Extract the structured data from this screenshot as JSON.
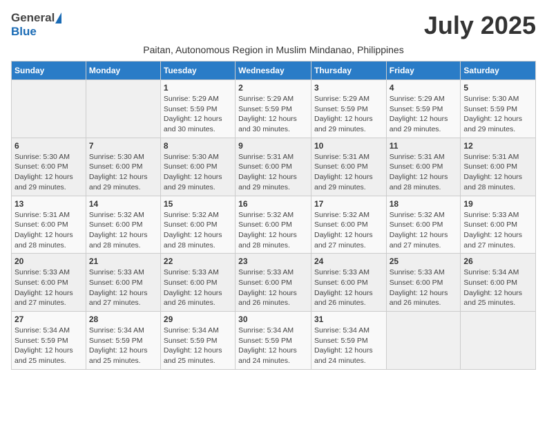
{
  "header": {
    "logo_general": "General",
    "logo_blue": "Blue",
    "title": "July 2025",
    "subtitle": "Paitan, Autonomous Region in Muslim Mindanao, Philippines"
  },
  "days_of_week": [
    "Sunday",
    "Monday",
    "Tuesday",
    "Wednesday",
    "Thursday",
    "Friday",
    "Saturday"
  ],
  "weeks": [
    [
      {
        "day": "",
        "info": ""
      },
      {
        "day": "",
        "info": ""
      },
      {
        "day": "1",
        "sunrise": "Sunrise: 5:29 AM",
        "sunset": "Sunset: 5:59 PM",
        "daylight": "Daylight: 12 hours and 30 minutes."
      },
      {
        "day": "2",
        "sunrise": "Sunrise: 5:29 AM",
        "sunset": "Sunset: 5:59 PM",
        "daylight": "Daylight: 12 hours and 30 minutes."
      },
      {
        "day": "3",
        "sunrise": "Sunrise: 5:29 AM",
        "sunset": "Sunset: 5:59 PM",
        "daylight": "Daylight: 12 hours and 29 minutes."
      },
      {
        "day": "4",
        "sunrise": "Sunrise: 5:29 AM",
        "sunset": "Sunset: 5:59 PM",
        "daylight": "Daylight: 12 hours and 29 minutes."
      },
      {
        "day": "5",
        "sunrise": "Sunrise: 5:30 AM",
        "sunset": "Sunset: 5:59 PM",
        "daylight": "Daylight: 12 hours and 29 minutes."
      }
    ],
    [
      {
        "day": "6",
        "sunrise": "Sunrise: 5:30 AM",
        "sunset": "Sunset: 6:00 PM",
        "daylight": "Daylight: 12 hours and 29 minutes."
      },
      {
        "day": "7",
        "sunrise": "Sunrise: 5:30 AM",
        "sunset": "Sunset: 6:00 PM",
        "daylight": "Daylight: 12 hours and 29 minutes."
      },
      {
        "day": "8",
        "sunrise": "Sunrise: 5:30 AM",
        "sunset": "Sunset: 6:00 PM",
        "daylight": "Daylight: 12 hours and 29 minutes."
      },
      {
        "day": "9",
        "sunrise": "Sunrise: 5:31 AM",
        "sunset": "Sunset: 6:00 PM",
        "daylight": "Daylight: 12 hours and 29 minutes."
      },
      {
        "day": "10",
        "sunrise": "Sunrise: 5:31 AM",
        "sunset": "Sunset: 6:00 PM",
        "daylight": "Daylight: 12 hours and 29 minutes."
      },
      {
        "day": "11",
        "sunrise": "Sunrise: 5:31 AM",
        "sunset": "Sunset: 6:00 PM",
        "daylight": "Daylight: 12 hours and 28 minutes."
      },
      {
        "day": "12",
        "sunrise": "Sunrise: 5:31 AM",
        "sunset": "Sunset: 6:00 PM",
        "daylight": "Daylight: 12 hours and 28 minutes."
      }
    ],
    [
      {
        "day": "13",
        "sunrise": "Sunrise: 5:31 AM",
        "sunset": "Sunset: 6:00 PM",
        "daylight": "Daylight: 12 hours and 28 minutes."
      },
      {
        "day": "14",
        "sunrise": "Sunrise: 5:32 AM",
        "sunset": "Sunset: 6:00 PM",
        "daylight": "Daylight: 12 hours and 28 minutes."
      },
      {
        "day": "15",
        "sunrise": "Sunrise: 5:32 AM",
        "sunset": "Sunset: 6:00 PM",
        "daylight": "Daylight: 12 hours and 28 minutes."
      },
      {
        "day": "16",
        "sunrise": "Sunrise: 5:32 AM",
        "sunset": "Sunset: 6:00 PM",
        "daylight": "Daylight: 12 hours and 28 minutes."
      },
      {
        "day": "17",
        "sunrise": "Sunrise: 5:32 AM",
        "sunset": "Sunset: 6:00 PM",
        "daylight": "Daylight: 12 hours and 27 minutes."
      },
      {
        "day": "18",
        "sunrise": "Sunrise: 5:32 AM",
        "sunset": "Sunset: 6:00 PM",
        "daylight": "Daylight: 12 hours and 27 minutes."
      },
      {
        "day": "19",
        "sunrise": "Sunrise: 5:33 AM",
        "sunset": "Sunset: 6:00 PM",
        "daylight": "Daylight: 12 hours and 27 minutes."
      }
    ],
    [
      {
        "day": "20",
        "sunrise": "Sunrise: 5:33 AM",
        "sunset": "Sunset: 6:00 PM",
        "daylight": "Daylight: 12 hours and 27 minutes."
      },
      {
        "day": "21",
        "sunrise": "Sunrise: 5:33 AM",
        "sunset": "Sunset: 6:00 PM",
        "daylight": "Daylight: 12 hours and 27 minutes."
      },
      {
        "day": "22",
        "sunrise": "Sunrise: 5:33 AM",
        "sunset": "Sunset: 6:00 PM",
        "daylight": "Daylight: 12 hours and 26 minutes."
      },
      {
        "day": "23",
        "sunrise": "Sunrise: 5:33 AM",
        "sunset": "Sunset: 6:00 PM",
        "daylight": "Daylight: 12 hours and 26 minutes."
      },
      {
        "day": "24",
        "sunrise": "Sunrise: 5:33 AM",
        "sunset": "Sunset: 6:00 PM",
        "daylight": "Daylight: 12 hours and 26 minutes."
      },
      {
        "day": "25",
        "sunrise": "Sunrise: 5:33 AM",
        "sunset": "Sunset: 6:00 PM",
        "daylight": "Daylight: 12 hours and 26 minutes."
      },
      {
        "day": "26",
        "sunrise": "Sunrise: 5:34 AM",
        "sunset": "Sunset: 6:00 PM",
        "daylight": "Daylight: 12 hours and 25 minutes."
      }
    ],
    [
      {
        "day": "27",
        "sunrise": "Sunrise: 5:34 AM",
        "sunset": "Sunset: 5:59 PM",
        "daylight": "Daylight: 12 hours and 25 minutes."
      },
      {
        "day": "28",
        "sunrise": "Sunrise: 5:34 AM",
        "sunset": "Sunset: 5:59 PM",
        "daylight": "Daylight: 12 hours and 25 minutes."
      },
      {
        "day": "29",
        "sunrise": "Sunrise: 5:34 AM",
        "sunset": "Sunset: 5:59 PM",
        "daylight": "Daylight: 12 hours and 25 minutes."
      },
      {
        "day": "30",
        "sunrise": "Sunrise: 5:34 AM",
        "sunset": "Sunset: 5:59 PM",
        "daylight": "Daylight: 12 hours and 24 minutes."
      },
      {
        "day": "31",
        "sunrise": "Sunrise: 5:34 AM",
        "sunset": "Sunset: 5:59 PM",
        "daylight": "Daylight: 12 hours and 24 minutes."
      },
      {
        "day": "",
        "info": ""
      },
      {
        "day": "",
        "info": ""
      }
    ]
  ]
}
